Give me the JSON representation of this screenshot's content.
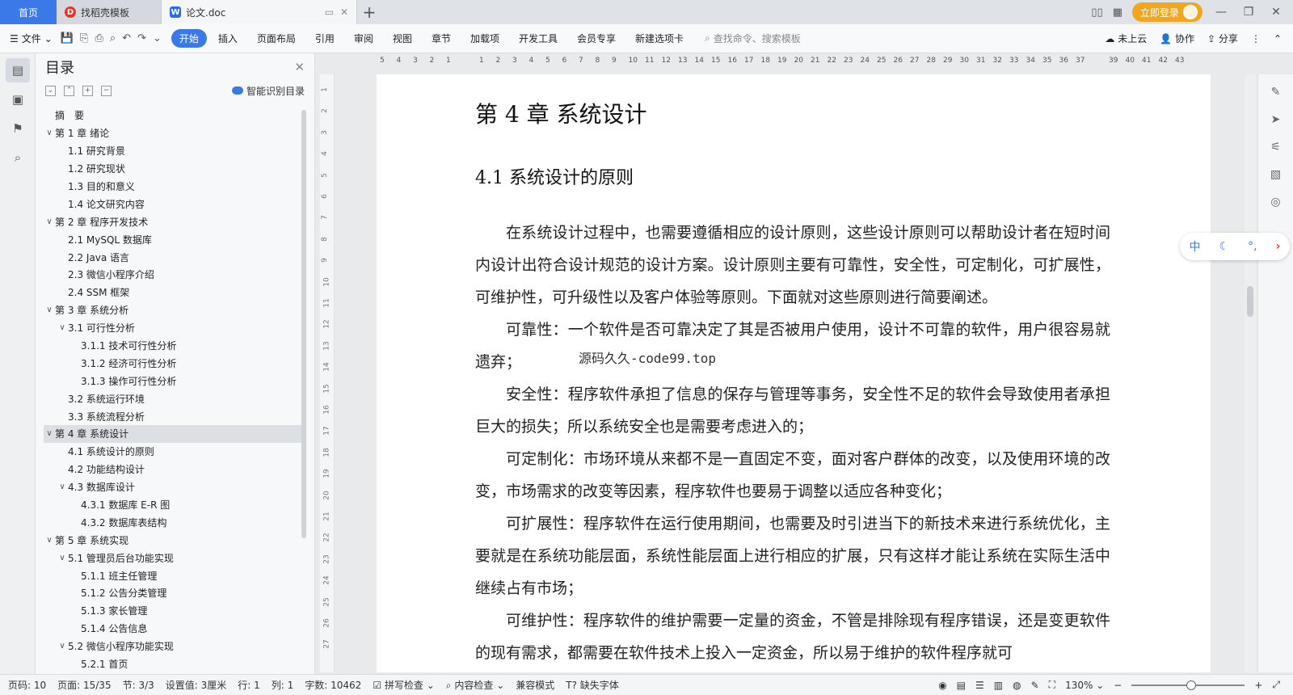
{
  "tabs": {
    "home": "首页",
    "tab1": "找稻壳模板",
    "tab2": "论文.doc"
  },
  "topbar": {
    "login": "立即登录"
  },
  "ribbon": {
    "file": "文件",
    "tabs": [
      "开始",
      "插入",
      "页面布局",
      "引用",
      "审阅",
      "视图",
      "章节",
      "加载项",
      "开发工具",
      "会员专享",
      "新建选项卡"
    ],
    "search_placeholder": "查找命令、搜索模板",
    "cloud": "未上云",
    "collab": "协作",
    "share": "分享"
  },
  "toc": {
    "title": "目录",
    "smart": "智能识别目录",
    "items": [
      {
        "label": "摘　要",
        "level": 1,
        "chev": ""
      },
      {
        "label": "第 1 章  绪论",
        "level": 1,
        "chev": "v"
      },
      {
        "label": "1.1  研究背景",
        "level": 2,
        "chev": ""
      },
      {
        "label": "1.2  研究现状",
        "level": 2,
        "chev": ""
      },
      {
        "label": "1.3  目的和意义",
        "level": 2,
        "chev": ""
      },
      {
        "label": "1.4  论文研究内容",
        "level": 2,
        "chev": ""
      },
      {
        "label": "第 2 章  程序开发技术",
        "level": 1,
        "chev": "v"
      },
      {
        "label": "2.1 MySQL 数据库",
        "level": 2,
        "chev": ""
      },
      {
        "label": "2.2 Java 语言",
        "level": 2,
        "chev": ""
      },
      {
        "label": "2.3  微信小程序介绍",
        "level": 2,
        "chev": ""
      },
      {
        "label": "2.4 SSM 框架",
        "level": 2,
        "chev": ""
      },
      {
        "label": "第 3 章  系统分析",
        "level": 1,
        "chev": "v"
      },
      {
        "label": "3.1 可行性分析",
        "level": 2,
        "chev": "v"
      },
      {
        "label": "3.1.1  技术可行性分析",
        "level": 3,
        "chev": ""
      },
      {
        "label": "3.1.2  经济可行性分析",
        "level": 3,
        "chev": ""
      },
      {
        "label": "3.1.3  操作可行性分析",
        "level": 3,
        "chev": ""
      },
      {
        "label": "3.2 系统运行环境",
        "level": 2,
        "chev": ""
      },
      {
        "label": "3.3 系统流程分析",
        "level": 2,
        "chev": ""
      },
      {
        "label": "第 4 章  系统设计",
        "level": 1,
        "chev": "v",
        "selected": true
      },
      {
        "label": "4.1  系统设计的原则",
        "level": 2,
        "chev": ""
      },
      {
        "label": "4.2  功能结构设计",
        "level": 2,
        "chev": ""
      },
      {
        "label": "4.3  数据库设计",
        "level": 2,
        "chev": "v"
      },
      {
        "label": "4.3.1  数据库 E-R 图",
        "level": 3,
        "chev": ""
      },
      {
        "label": "4.3.2  数据库表结构",
        "level": 3,
        "chev": ""
      },
      {
        "label": "第 5 章  系统实现",
        "level": 1,
        "chev": "v"
      },
      {
        "label": "5.1 管理员后台功能实现",
        "level": 2,
        "chev": "v"
      },
      {
        "label": "5.1.1  班主任管理",
        "level": 3,
        "chev": ""
      },
      {
        "label": "5.1.2  公告分类管理",
        "level": 3,
        "chev": ""
      },
      {
        "label": "5.1.3  家长管理",
        "level": 3,
        "chev": ""
      },
      {
        "label": "5.1.4  公告信息",
        "level": 3,
        "chev": ""
      },
      {
        "label": "5.2  微信小程序功能实现",
        "level": 2,
        "chev": "v"
      },
      {
        "label": "5.2.1  首页",
        "level": 3,
        "chev": ""
      }
    ]
  },
  "ruler": {
    "h_ticks": [
      "5",
      "4",
      "3",
      "2",
      "1",
      "",
      "1",
      "2",
      "3",
      "4",
      "5",
      "6",
      "7",
      "8",
      "9",
      "10",
      "11",
      "12",
      "13",
      "14",
      "15",
      "16",
      "17",
      "18",
      "19",
      "20",
      "21",
      "22",
      "23",
      "24",
      "25",
      "26",
      "27",
      "28",
      "29",
      "30",
      "31",
      "32",
      "33",
      "34",
      "35",
      "36",
      "37",
      "",
      "39",
      "40",
      "41",
      "42",
      "43"
    ],
    "v_ticks": [
      "1",
      "2",
      "3",
      "4",
      "5",
      "6",
      "7",
      "8",
      "9",
      "10",
      "11",
      "12",
      "13",
      "14",
      "15",
      "16",
      "17",
      "18",
      "19",
      "20",
      "21",
      "22",
      "23",
      "24",
      "25",
      "26",
      "27"
    ]
  },
  "document": {
    "h1": "第 4 章  系统设计",
    "h2": "4.1  系统设计的原则",
    "paragraphs": [
      "在系统设计过程中，也需要遵循相应的设计原则，这些设计原则可以帮助设计者在短时间内设计出符合设计规范的设计方案。设计原则主要有可靠性，安全性，可定制化，可扩展性，可维护性，可升级性以及客户体验等原则。下面就对这些原则进行简要阐述。",
      "可靠性：一个软件是否可靠决定了其是否被用户使用，设计不可靠的软件，用户很容易就遗弃；",
      "安全性：程序软件承担了信息的保存与管理等事务，安全性不足的软件会导致使用者承担巨大的损失；所以系统安全也是需要考虑进入的；",
      "可定制化：市场环境从来都不是一直固定不变，面对客户群体的改变，以及使用环境的改变，市场需求的改变等因素，程序软件也要易于调整以适应各种变化；",
      "可扩展性：程序软件在运行使用期间，也需要及时引进当下的新技术来进行系统优化，主要就是在系统功能层面，系统性能层面上进行相应的扩展，只有这样才能让系统在实际生活中继续占有市场；",
      "可维护性：程序软件的维护需要一定量的资金，不管是排除现有程序错误，还是变更软件的现有需求，都需要在软件技术上投入一定资金，所以易于维护的软件程序就可"
    ],
    "watermark": "源码久久-code99.top"
  },
  "floatbar": {
    "lang": "中"
  },
  "status": {
    "page_code": "页码: 10",
    "pages": "页面: 15/35",
    "section": "节: 3/3",
    "setting": "设置值: 3厘米",
    "row": "行: 1",
    "col": "列: 1",
    "words": "字数: 10462",
    "spell": "拼写检查",
    "content": "内容检查",
    "compat": "兼容模式",
    "missing_font": "缺失字体",
    "zoom": "130%"
  }
}
